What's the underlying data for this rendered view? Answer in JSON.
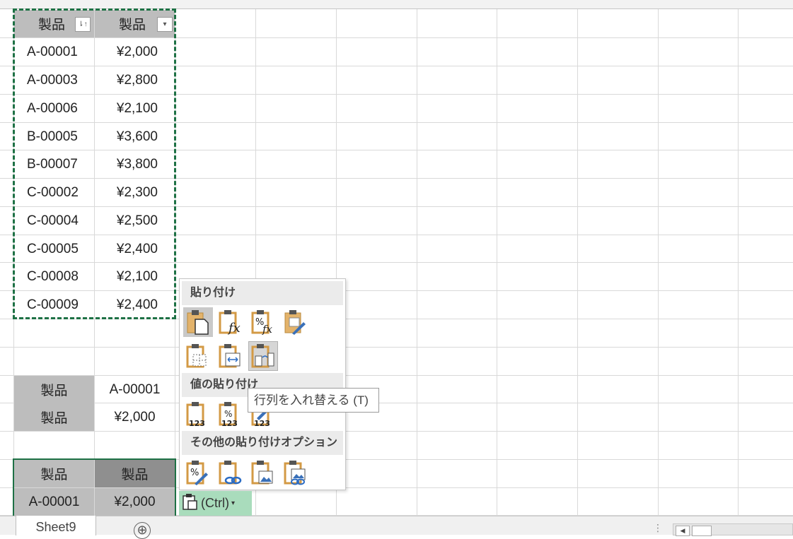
{
  "sheet": {
    "header_row": {
      "a": "製品",
      "b": "製品"
    },
    "rows": [
      {
        "a": "A-00001",
        "b": "¥2,000"
      },
      {
        "a": "A-00003",
        "b": "¥2,800"
      },
      {
        "a": "A-00006",
        "b": "¥2,100"
      },
      {
        "a": "B-00005",
        "b": "¥3,600"
      },
      {
        "a": "B-00007",
        "b": "¥3,800"
      },
      {
        "a": "C-00002",
        "b": "¥2,300"
      },
      {
        "a": "C-00004",
        "b": "¥2,500"
      },
      {
        "a": "C-00005",
        "b": "¥2,400"
      },
      {
        "a": "C-00008",
        "b": "¥2,100"
      },
      {
        "a": "C-00009",
        "b": "¥2,400"
      }
    ],
    "transposed": {
      "row1": {
        "a": "製品",
        "b": "A-00001"
      },
      "row2": {
        "a": "製品",
        "b": "¥2,000"
      }
    },
    "pasted": {
      "header": {
        "a": "製品",
        "b": "製品"
      },
      "row": {
        "a": "A-00001",
        "b": "¥2,000"
      }
    }
  },
  "paste_menu": {
    "section_paste": "貼り付け",
    "section_values": "値の貼り付け",
    "section_other": "その他の貼り付けオプション",
    "tooltip": "行列を入れ替える (T)",
    "ctrl_label": "(Ctrl)",
    "value_icon_digits": "123",
    "percent_glyph": "%",
    "fx_glyph": "fx"
  },
  "status": {
    "sheet_tab": "Sheet9",
    "add_sheet": "⊕"
  },
  "colors": {
    "selection_green": "#1e7145",
    "header_gray": "#bdbdbd",
    "clipboard_orange": "#e3b36b",
    "ctrl_green": "#a9dcbc"
  }
}
